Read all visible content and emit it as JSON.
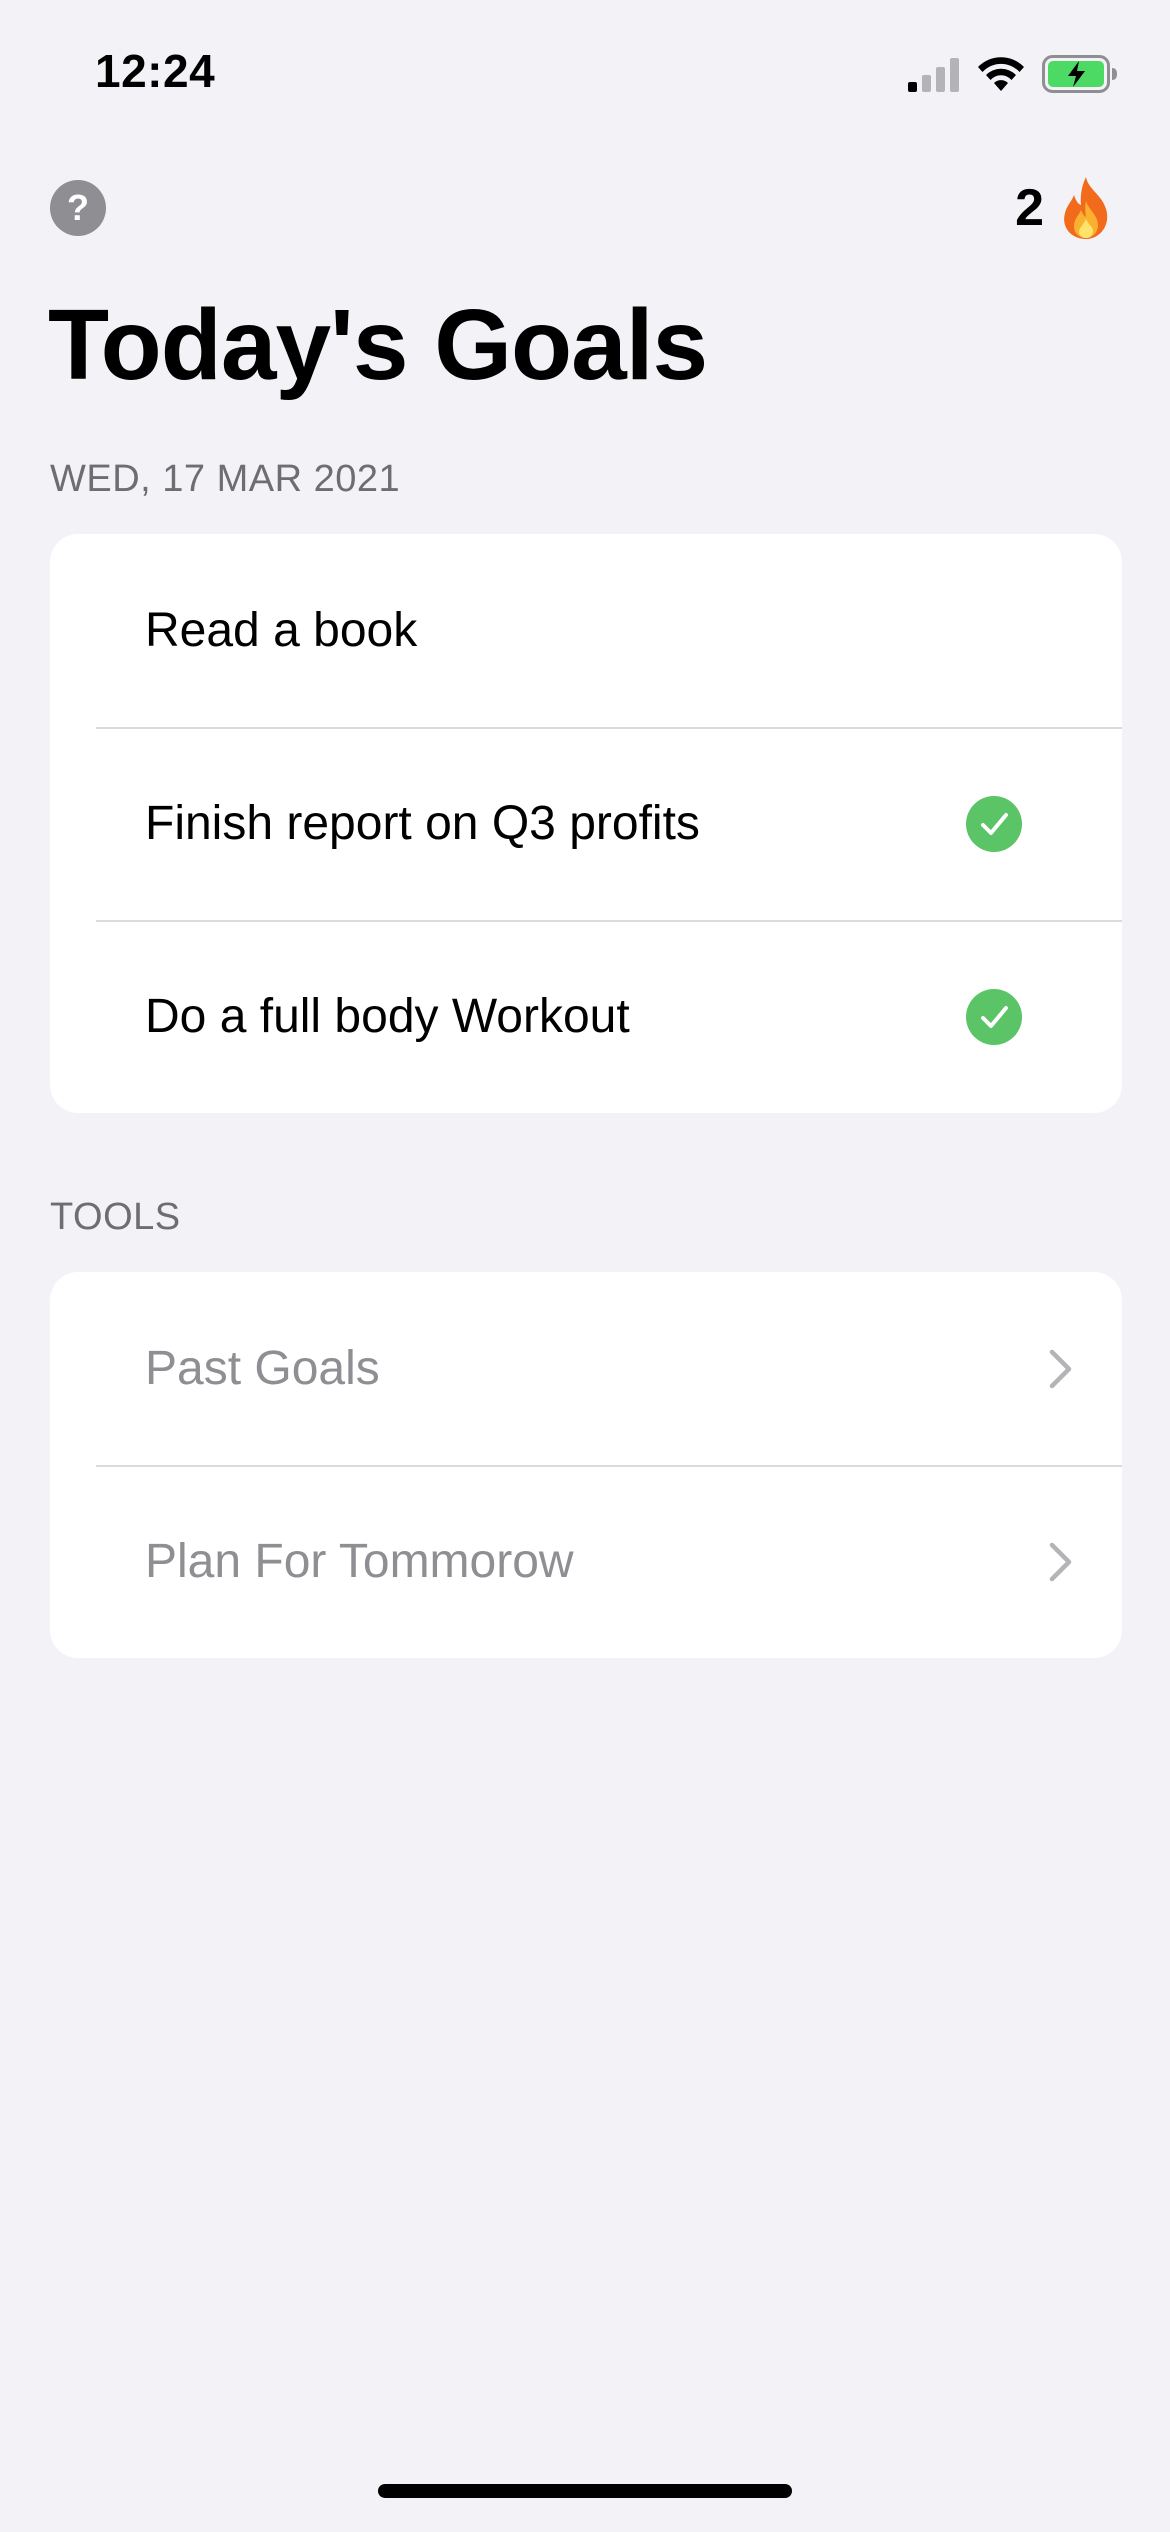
{
  "status_bar": {
    "time": "12:24"
  },
  "header": {
    "help_label": "?",
    "streak_count": "2",
    "streak_icon": "fire-icon"
  },
  "page": {
    "title": "Today's Goals",
    "date": "WED, 17 MAR 2021"
  },
  "goals": [
    {
      "label": "Read a book",
      "completed": false
    },
    {
      "label": "Finish report on Q3 profits",
      "completed": true
    },
    {
      "label": "Do a full body Workout",
      "completed": true
    }
  ],
  "tools": {
    "header": "TOOLS",
    "items": [
      {
        "label": "Past Goals"
      },
      {
        "label": "Plan For Tommorow"
      }
    ]
  },
  "colors": {
    "background": "#f2f2f7",
    "check_green": "#5ac466",
    "muted_text": "#8e8e93",
    "section_header": "#6d6d72",
    "battery_green": "#4cd964"
  }
}
